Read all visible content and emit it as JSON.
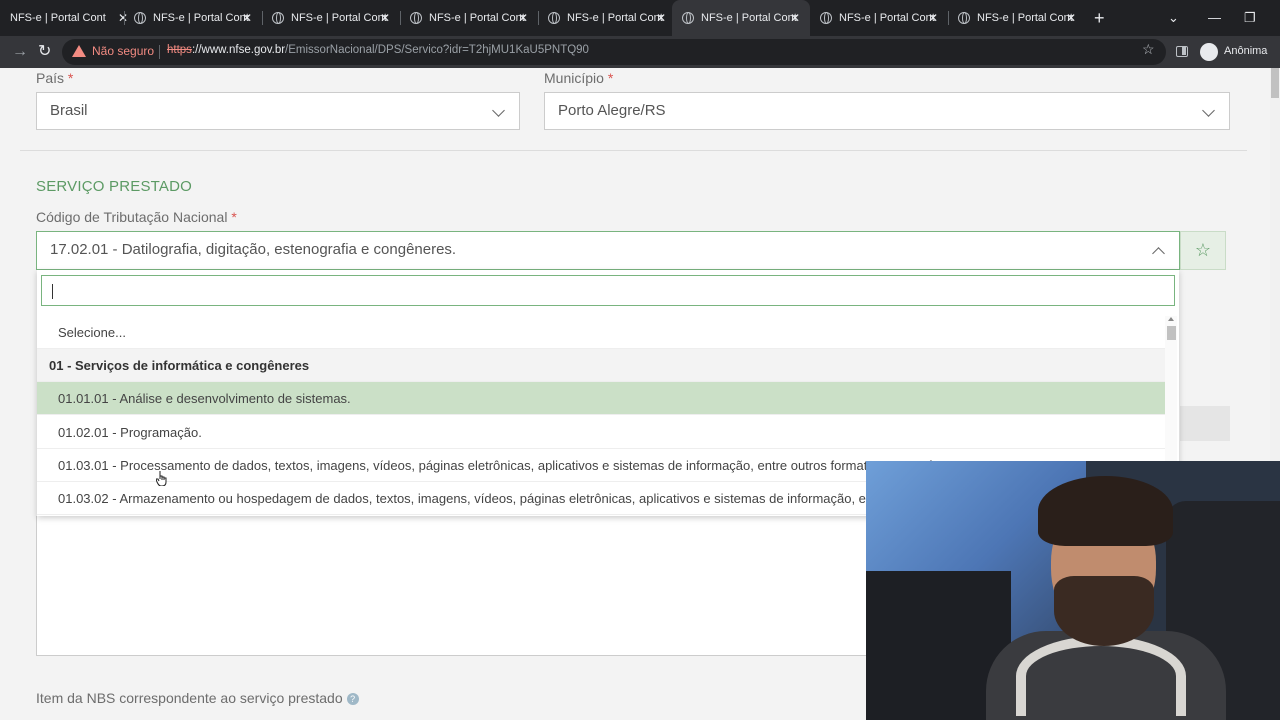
{
  "browser": {
    "tabs": [
      {
        "title": "NFS-e | Portal Cont",
        "active": false
      },
      {
        "title": "NFS-e | Portal Cont",
        "active": false
      },
      {
        "title": "NFS-e | Portal Cont",
        "active": false
      },
      {
        "title": "NFS-e | Portal Cont",
        "active": false
      },
      {
        "title": "NFS-e | Portal Cont",
        "active": false
      },
      {
        "title": "NFS-e | Portal Cont",
        "active": true
      },
      {
        "title": "NFS-e | Portal Cont",
        "active": false
      },
      {
        "title": "NFS-e | Portal Cont",
        "active": false
      }
    ],
    "security_label": "Não seguro",
    "url_protocol": "https",
    "url_sep": "://",
    "url_host": "www.nfse.gov.br",
    "url_path": "/EmissorNacional/DPS/Servico?idr=T2hjMU1KaU5PNTQ90",
    "profile_label": "Anônima"
  },
  "form": {
    "pais_label": "País",
    "pais_value": "Brasil",
    "municipio_label": "Município",
    "municipio_value": "Porto Alegre/RS",
    "required_mark": "*",
    "section_title": "SERVIÇO PRESTADO",
    "codigo_label": "Código de Tributação Nacional",
    "codigo_value": "17.02.01 - Datilografia, digitação, estenografia e congêneres.",
    "nbs_label": "Item da NBS correspondente ao serviço prestado",
    "help_glyph": "?"
  },
  "dropdown": {
    "search_value": "",
    "options": [
      {
        "text": "Selecione...",
        "kind": "option"
      },
      {
        "text": "01 - Serviços de informática e congêneres",
        "kind": "group"
      },
      {
        "text": "01.01.01 - Análise e desenvolvimento de sistemas.",
        "kind": "highlighted"
      },
      {
        "text": "01.02.01 - Programação.",
        "kind": "option"
      },
      {
        "text": "01.03.01 - Processamento de dados, textos, imagens, vídeos, páginas eletrônicas, aplicativos e sistemas de informação, entre outros formatos, e congêneres.",
        "kind": "option"
      },
      {
        "text": "01.03.02 - Armazenamento ou hospedagem de dados, textos, imagens, vídeos, páginas eletrônicas, aplicativos e sistemas de informação, entre outros formatos, e congêneres.",
        "kind": "option"
      }
    ]
  },
  "colors": {
    "accent_green": "#5c9a64",
    "highlight_green": "#cbe0c7",
    "required_red": "#d9534f",
    "warning_red": "#f28b82"
  },
  "icons": {
    "close": "close-icon",
    "star": "star-icon",
    "chevron": "chevron-down-icon",
    "warning": "warning-icon"
  }
}
